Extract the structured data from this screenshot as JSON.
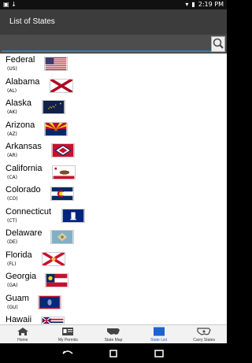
{
  "status": {
    "time": "2:19 PM"
  },
  "app": {
    "title": "List of States"
  },
  "search": {
    "placeholder": ""
  },
  "states": [
    {
      "name": "Federal",
      "code": "(US)"
    },
    {
      "name": "Alabama",
      "code": "(AL)"
    },
    {
      "name": "Alaska",
      "code": "(AK)"
    },
    {
      "name": "Arizona",
      "code": "(AZ)"
    },
    {
      "name": "Arkansas",
      "code": "(AR)"
    },
    {
      "name": "California",
      "code": "(CA)"
    },
    {
      "name": "Colorado",
      "code": "(CO)"
    },
    {
      "name": "Connecticut",
      "code": "(CT)"
    },
    {
      "name": "Delaware",
      "code": "(DE)"
    },
    {
      "name": "Florida",
      "code": "(FL)"
    },
    {
      "name": "Georgia",
      "code": "(GA)"
    },
    {
      "name": "Guam",
      "code": "(GU)"
    },
    {
      "name": "Hawaii",
      "code": ""
    }
  ],
  "tabs": [
    {
      "label": "Home",
      "icon": "home-icon"
    },
    {
      "label": "My Permits",
      "icon": "permit-card-icon"
    },
    {
      "label": "State Map",
      "icon": "us-map-icon"
    },
    {
      "label": "State List",
      "icon": "list-icon",
      "active": true
    },
    {
      "label": "Carry States",
      "icon": "carry-map-icon"
    }
  ]
}
